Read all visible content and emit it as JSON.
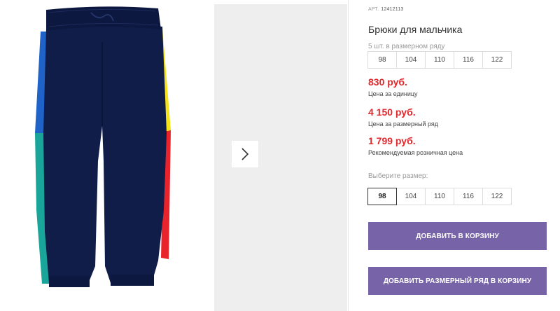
{
  "product": {
    "sku_label": "АРТ.",
    "sku": "12412113",
    "title": "Брюки для мальчика",
    "pack_caption": "5 шт. в размерном ряду",
    "pack_sizes": [
      "98",
      "104",
      "110",
      "116",
      "122"
    ],
    "prices": [
      {
        "value": "830 руб.",
        "caption": "Цена за единицу"
      },
      {
        "value": "4 150 руб.",
        "caption": "Цена за размерный ряд"
      },
      {
        "value": "1 799 руб.",
        "caption": "Рекомендуемая розничная цена"
      }
    ],
    "size_select_caption": "Выберите размер:",
    "select_sizes": [
      "98",
      "104",
      "110",
      "116",
      "122"
    ],
    "selected_size": "98",
    "add_to_cart_label": "ДОБАВИТЬ В КОРЗИНУ",
    "add_pack_to_cart_label": "ДОБАВИТЬ РАЗМЕРНЫЙ РЯД В КОРЗИНУ"
  },
  "colors": {
    "price_red": "#e0282d",
    "button_purple": "#7763a7",
    "pants_navy": "#0f1e4b",
    "stripe_blue": "#1f63c8",
    "stripe_teal": "#1aa59a",
    "stripe_yellow": "#f5e21a",
    "stripe_red": "#e8232c"
  },
  "icons": {
    "next": "chevron-right-icon"
  }
}
